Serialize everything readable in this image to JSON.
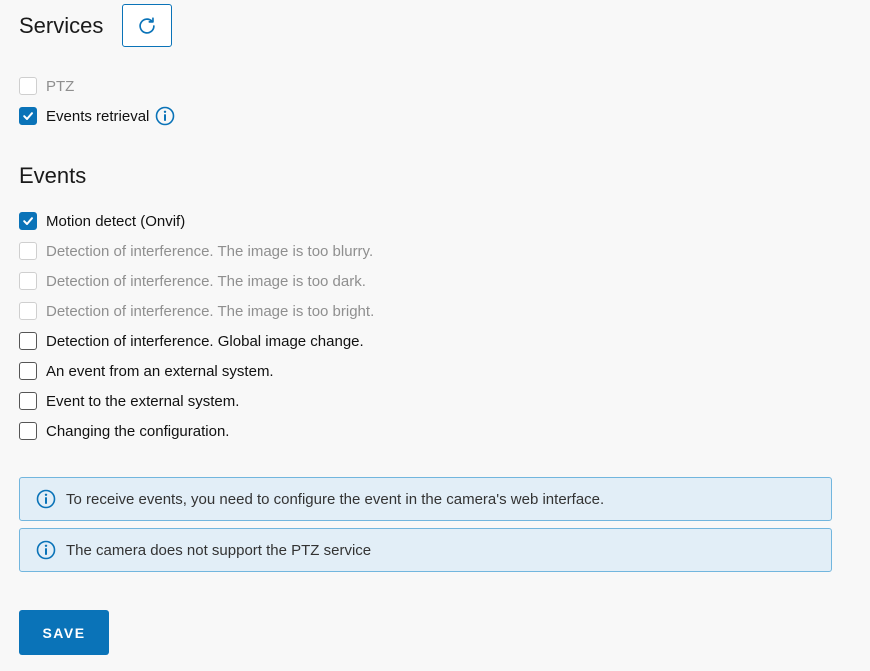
{
  "services": {
    "title": "Services",
    "refresh_icon": "refresh-icon",
    "items": [
      {
        "label": "PTZ",
        "checked": false,
        "disabled": true,
        "info": false
      },
      {
        "label": "Events retrieval",
        "checked": true,
        "disabled": false,
        "info": true
      }
    ]
  },
  "events": {
    "title": "Events",
    "items": [
      {
        "label": "Motion detect (Onvif)",
        "checked": true,
        "disabled": false
      },
      {
        "label": "Detection of interference. The image is too blurry.",
        "checked": false,
        "disabled": true
      },
      {
        "label": "Detection of interference. The image is too dark.",
        "checked": false,
        "disabled": true
      },
      {
        "label": "Detection of interference. The image is too bright.",
        "checked": false,
        "disabled": true
      },
      {
        "label": "Detection of interference. Global image change.",
        "checked": false,
        "disabled": false
      },
      {
        "label": "An event from an external system.",
        "checked": false,
        "disabled": false
      },
      {
        "label": "Event to the external system.",
        "checked": false,
        "disabled": false
      },
      {
        "label": "Changing the configuration.",
        "checked": false,
        "disabled": false
      }
    ]
  },
  "notices": [
    {
      "text": "To receive events, you need to configure the event in the camera's web interface.",
      "icon": "info-icon"
    },
    {
      "text": "The camera does not support the PTZ service",
      "icon": "info-icon"
    }
  ],
  "save_label": "SAVE",
  "colors": {
    "accent": "#0a73b8",
    "notice_bg": "#e2eef7",
    "notice_border": "#72b6de",
    "disabled_text": "#8f8f8f"
  }
}
